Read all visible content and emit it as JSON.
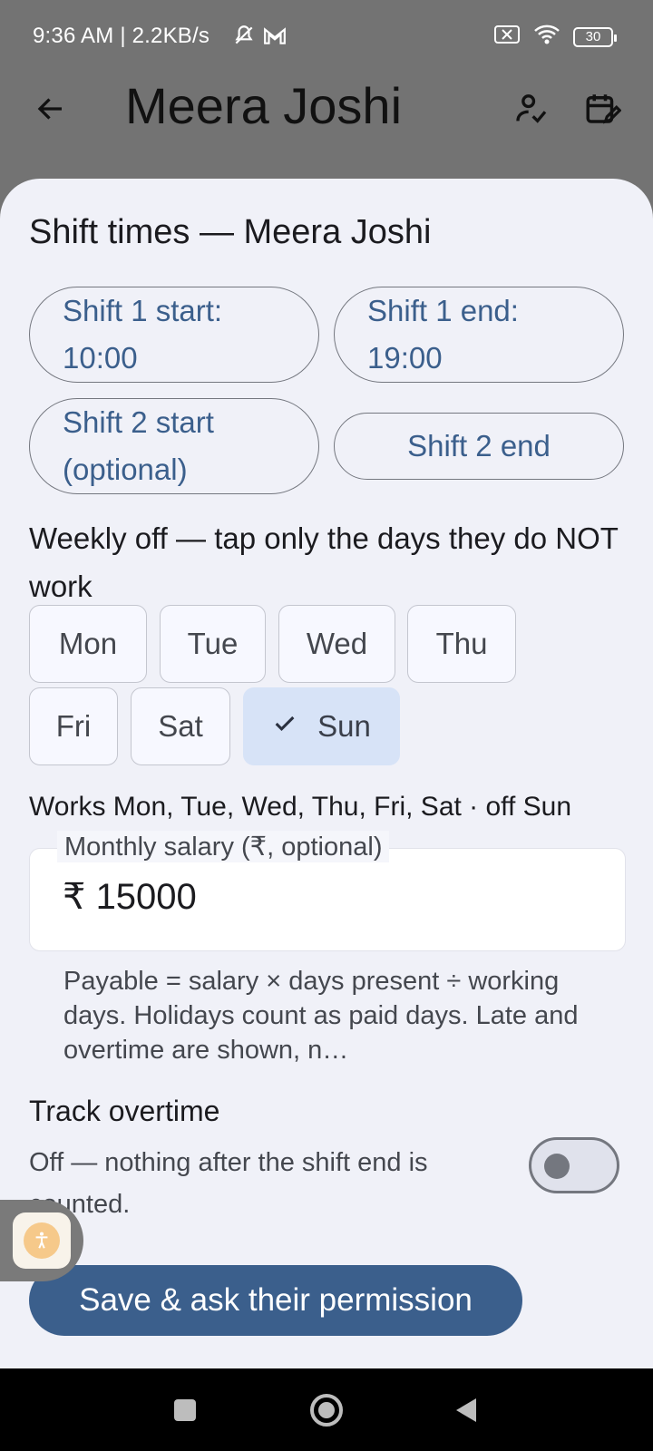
{
  "status_bar": {
    "left_text": "9:36 AM | 2.2KB/s",
    "icons_left": [
      "mute-icon",
      "gmail-icon"
    ],
    "icons_right": [
      "sim-x-icon",
      "wifi-icon",
      "battery-icon"
    ],
    "battery": "30"
  },
  "app_bar": {
    "title": "Meera Joshi",
    "icons": [
      "back-arrow-icon",
      "person-check-icon",
      "calendar-edit-icon"
    ]
  },
  "sheet": {
    "title": "Shift times — Meera Joshi",
    "shift_buttons": {
      "shift1_start": "Shift 1 start: 10:00",
      "shift1_end": "Shift 1 end: 19:00",
      "shift2_start": "Shift 2 start (optional)",
      "shift2_end": "Shift 2 end"
    },
    "weekly_off_label": "Weekly off — tap only the days they do NOT work",
    "days": [
      {
        "label": "Mon",
        "selected": false
      },
      {
        "label": "Tue",
        "selected": false
      },
      {
        "label": "Wed",
        "selected": false
      },
      {
        "label": "Thu",
        "selected": false
      },
      {
        "label": "Fri",
        "selected": false
      },
      {
        "label": "Sat",
        "selected": false
      },
      {
        "label": "Sun",
        "selected": true
      }
    ],
    "works_summary": "Works Mon, Tue, Wed, Thu, Fri, Sat · off Sun",
    "salary": {
      "label": "Monthly salary (₹, optional)",
      "value": "₹ 15000"
    },
    "salary_help": "Payable = salary × days present ÷ working days. Holidays count as paid days. Late and overtime are shown, n…",
    "overtime": {
      "title": "Track overtime",
      "description": "Off — nothing after the shift end is counted.",
      "enabled": false
    },
    "save_button": "Save & ask their permission"
  },
  "colors": {
    "primary": "#3b5f8c",
    "sheet_bg": "#f0f1f8",
    "scrim": "#737373",
    "chip_selected": "#d7e3f7"
  }
}
